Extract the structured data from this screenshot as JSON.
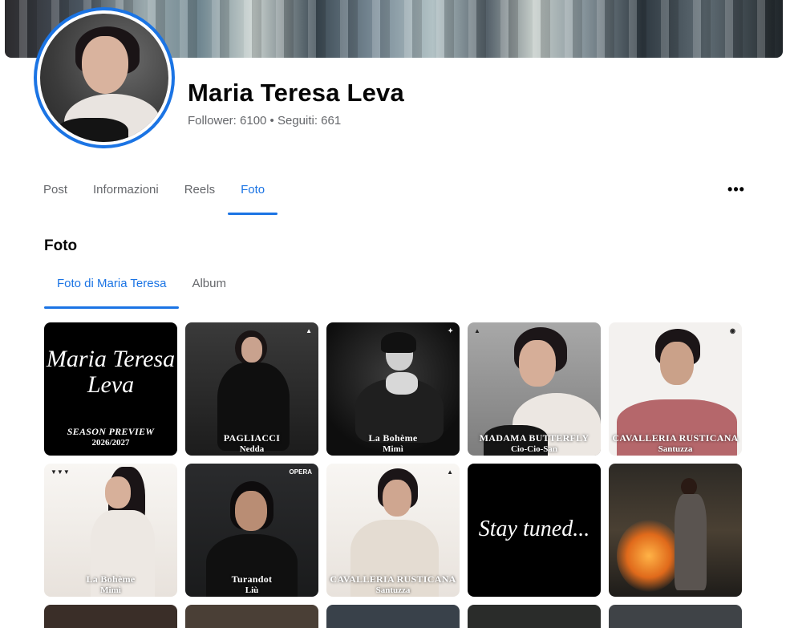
{
  "profile": {
    "name": "Maria Teresa Leva",
    "stats": "Follower: 6100 • Seguiti: 661"
  },
  "tabs": [
    {
      "label": "Post"
    },
    {
      "label": "Informazioni"
    },
    {
      "label": "Reels"
    },
    {
      "label": "Foto"
    }
  ],
  "more_icon": "more-horizontal-icon",
  "section": {
    "title": "Foto",
    "subtabs": [
      {
        "label": "Foto di Maria Teresa"
      },
      {
        "label": "Album"
      }
    ]
  },
  "photos": [
    {
      "big1": "Maria Teresa",
      "big2": "Leva",
      "t1": "SEASON PREVIEW",
      "t2": "2026/2027"
    },
    {
      "t1": "PAGLIACCI",
      "t2": "Nedda"
    },
    {
      "t1": "La Bohème",
      "t2": "Mimì"
    },
    {
      "t1": "MADAMA BUTTERFLY",
      "t2": "Cio-Cio-San"
    },
    {
      "t1": "CAVALLERIA RUSTICANA",
      "t2": "Santuzza"
    },
    {
      "t1": "La Bohème",
      "t2": "Mimì"
    },
    {
      "logo": "OPERA",
      "t1": "Turandot",
      "t2": "Liù"
    },
    {
      "t1": "CAVALLERIA RUSTICANA",
      "t2": "Santuzza"
    },
    {
      "big1": "Stay tuned..."
    },
    {}
  ],
  "colors": {
    "accent": "#1b74e4",
    "text": "#050505",
    "secondary_text": "#65676b"
  }
}
